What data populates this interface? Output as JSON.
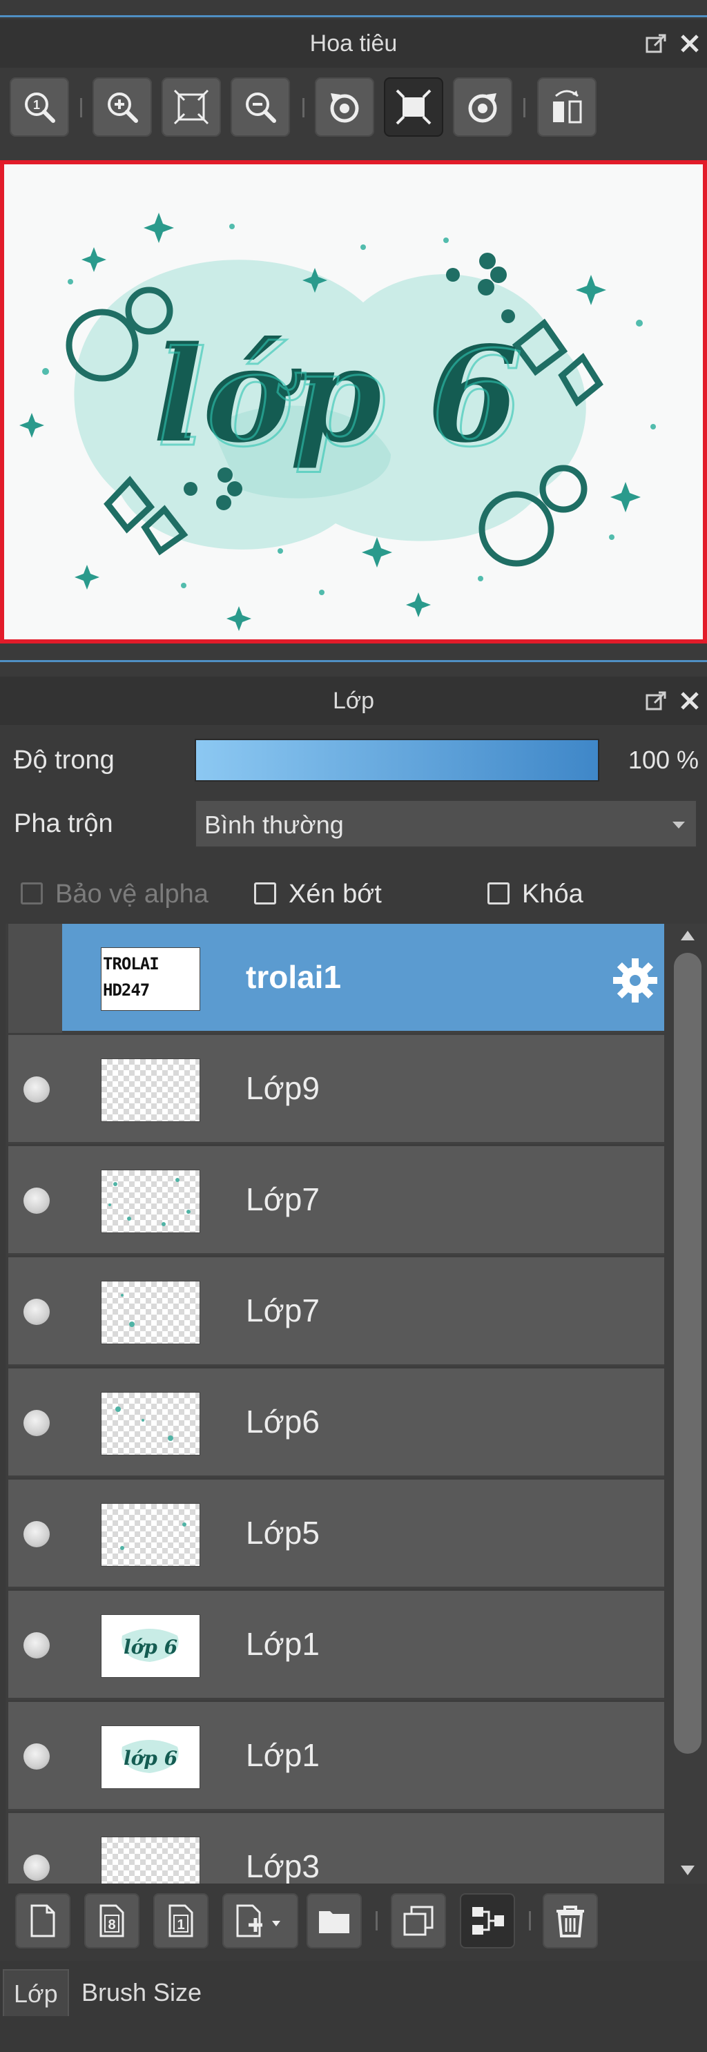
{
  "navigator": {
    "title": "Hoa tiêu",
    "tools": [
      {
        "icon": "zoom-actual-size-icon"
      },
      {
        "icon": "zoom-in-icon"
      },
      {
        "icon": "fit-to-window-icon"
      },
      {
        "icon": "zoom-out-icon"
      },
      {
        "icon": "rotate-left-icon"
      },
      {
        "icon": "fit-canvas-icon"
      },
      {
        "icon": "rotate-right-icon"
      },
      {
        "icon": "flip-horizontal-icon"
      }
    ]
  },
  "layers_panel": {
    "title": "Lớp",
    "opacity_label": "Độ trong",
    "opacity_value": "100 %",
    "opacity_fraction": 1.0,
    "blend_label": "Pha trộn",
    "blend_value": "Bình thường",
    "protect_alpha": "Bảo vệ alpha",
    "clipping": "Xén bớt",
    "lock": "Khóa",
    "thumb_text_1": "TROLAI",
    "thumb_text_2": "HD247",
    "layers": [
      {
        "name": "trolai1",
        "selected": true
      },
      {
        "name": "Lớp9"
      },
      {
        "name": "Lớp7"
      },
      {
        "name": "Lớp7"
      },
      {
        "name": "Lớp6"
      },
      {
        "name": "Lớp5"
      },
      {
        "name": "Lớp1"
      },
      {
        "name": "Lớp1"
      },
      {
        "name": "Lớp3"
      }
    ]
  },
  "bottom_tools": [
    {
      "icon": "new-layer-icon"
    },
    {
      "icon": "new-8bit-layer-icon"
    },
    {
      "icon": "new-1bit-layer-icon"
    },
    {
      "icon": "add-layer-menu-icon"
    },
    {
      "icon": "folder-icon"
    },
    {
      "icon": "duplicate-layer-icon"
    },
    {
      "icon": "merge-down-icon"
    },
    {
      "icon": "delete-icon"
    }
  ],
  "tabs": [
    {
      "label": "Lớp",
      "active": true
    },
    {
      "label": "Brush Size"
    }
  ],
  "colors": {
    "accent": "#5b9bd0",
    "canvas_border": "#e21c2a",
    "teal": "#1f7a6e"
  }
}
